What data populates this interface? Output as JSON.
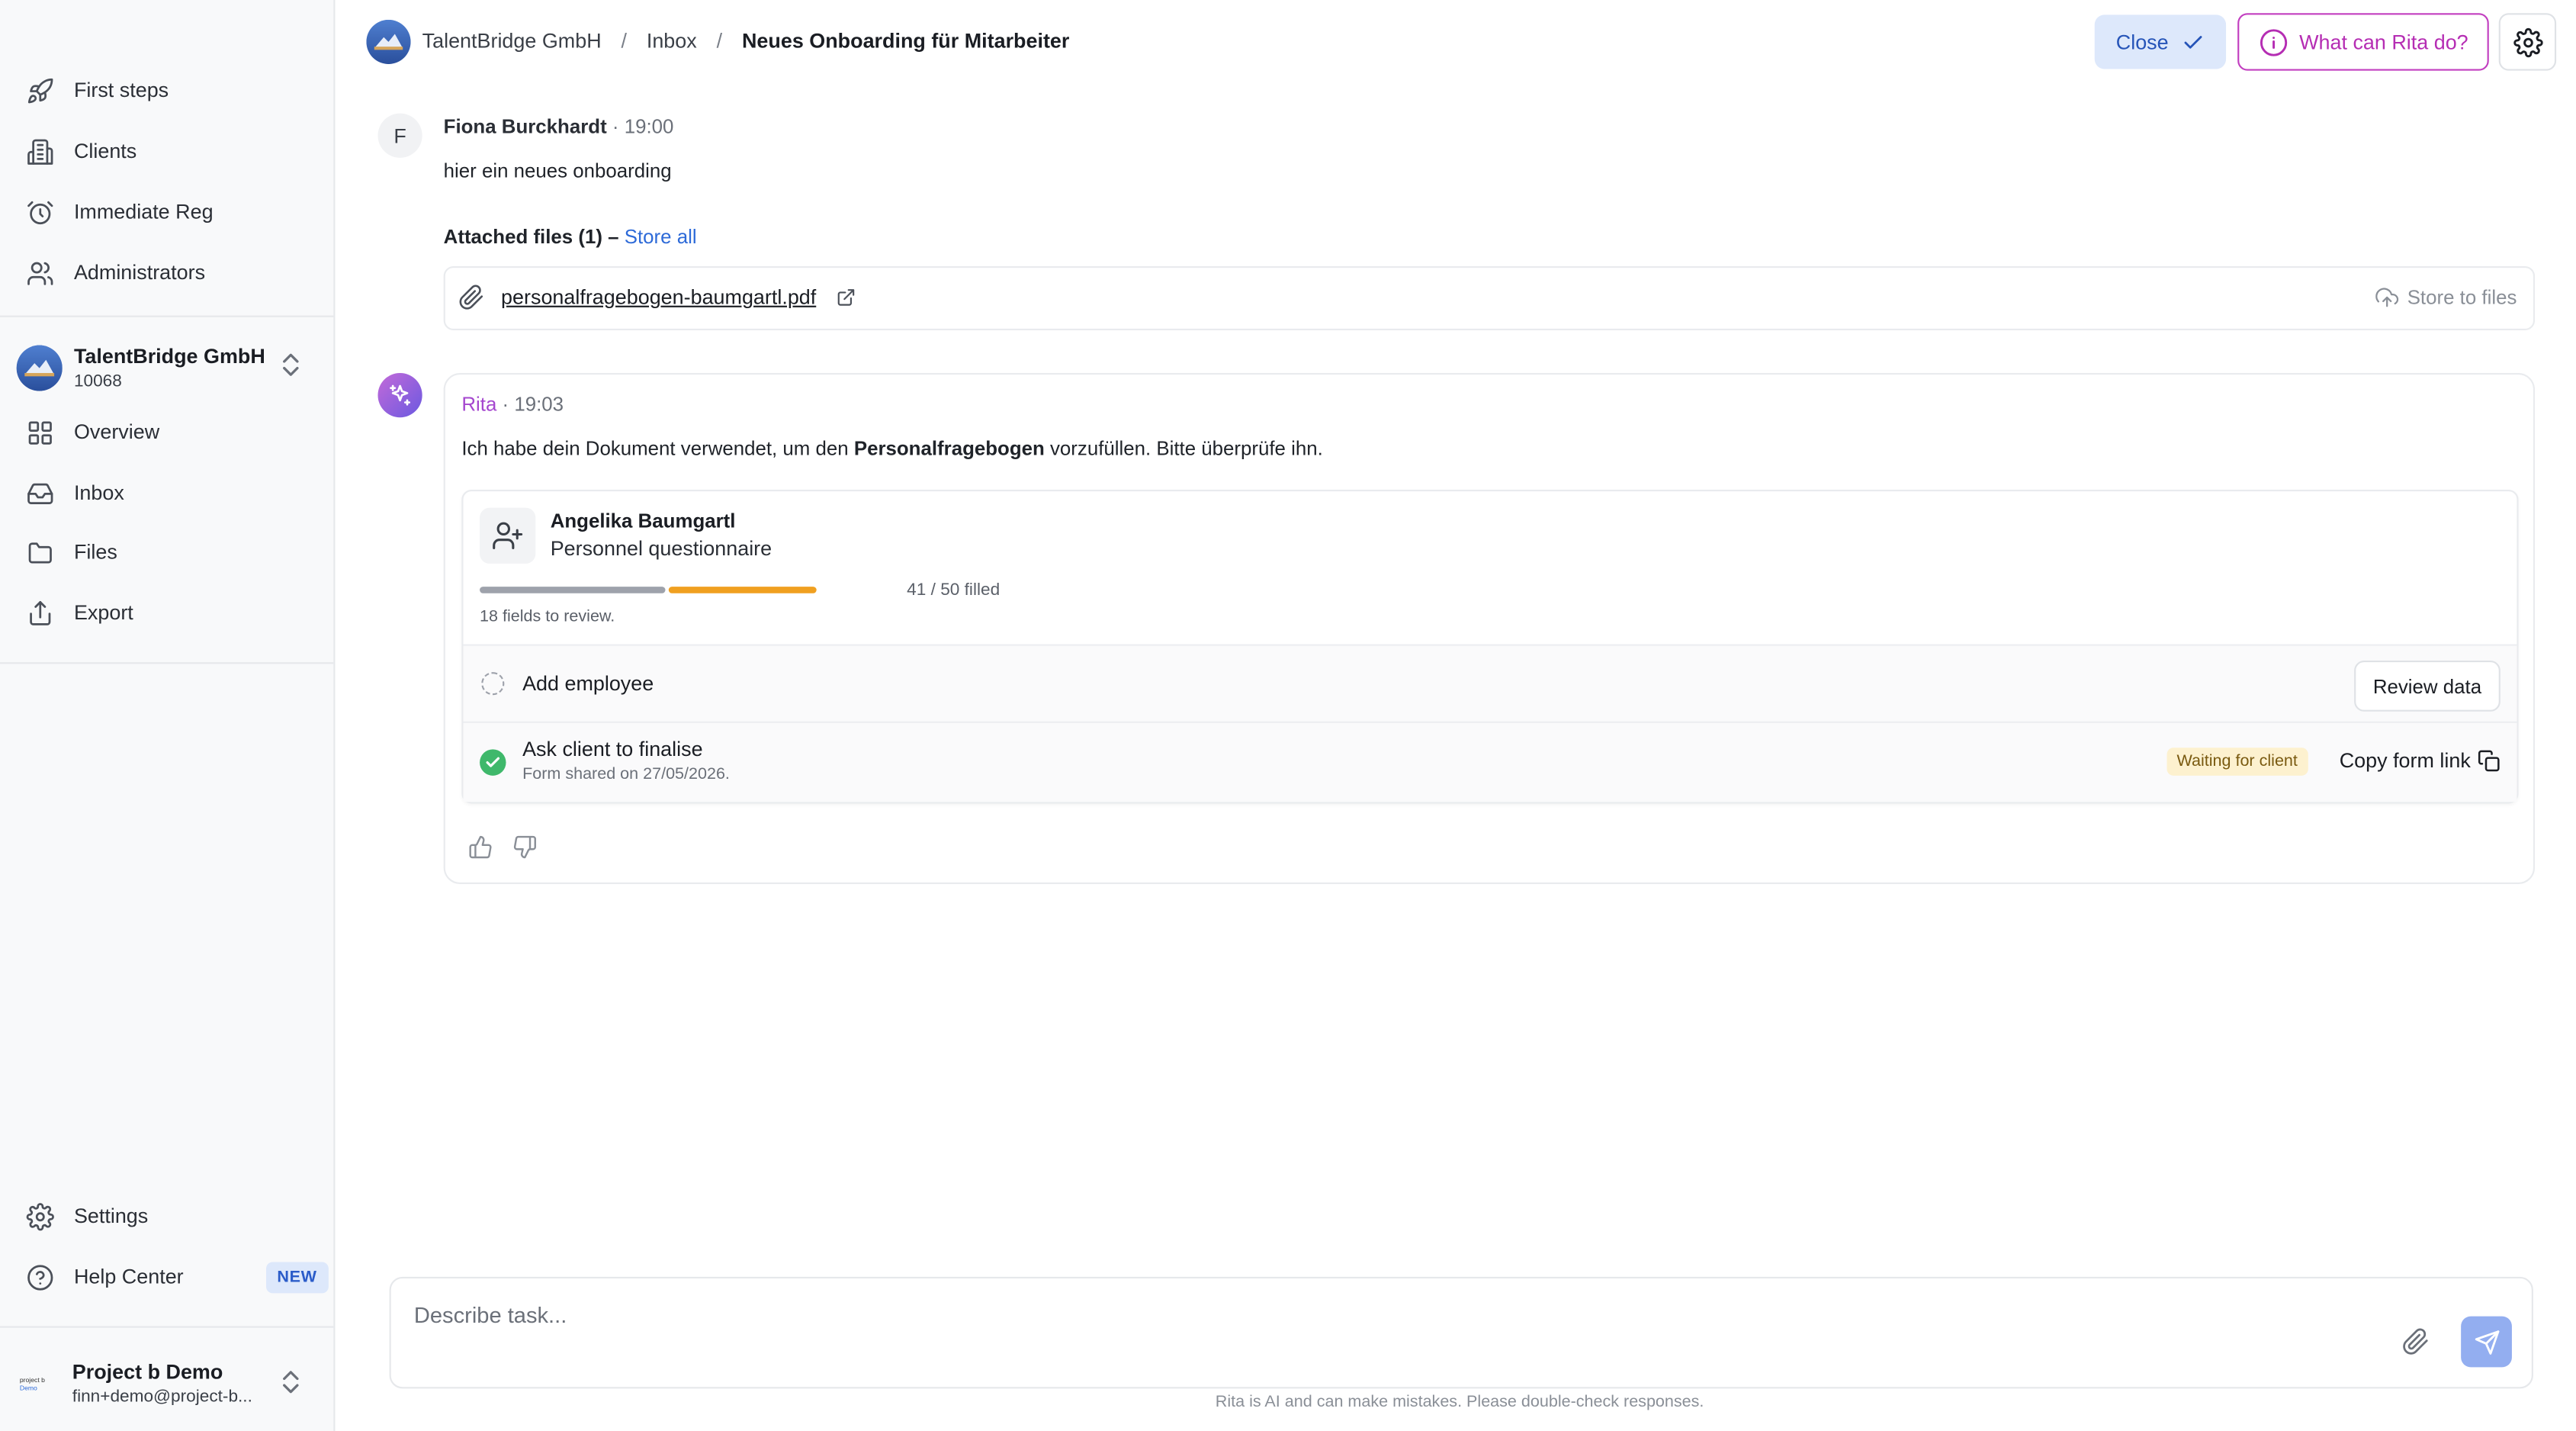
{
  "sidebar": {
    "top_items": [
      {
        "label": "First steps",
        "icon": "rocket-icon"
      },
      {
        "label": "Clients",
        "icon": "building-icon"
      },
      {
        "label": "Immediate Reg",
        "icon": "alarm-icon"
      },
      {
        "label": "Administrators",
        "icon": "users-icon"
      }
    ],
    "org": {
      "name": "TalentBridge GmbH",
      "id": "10068"
    },
    "org_items": [
      {
        "label": "Overview",
        "icon": "grid-icon"
      },
      {
        "label": "Inbox",
        "icon": "inbox-icon"
      },
      {
        "label": "Files",
        "icon": "folder-icon"
      },
      {
        "label": "Export",
        "icon": "export-icon"
      }
    ],
    "settings_label": "Settings",
    "help_label": "Help Center",
    "help_badge": "NEW",
    "user": {
      "name": "Project b Demo",
      "email": "finn+demo@project-b...",
      "logo_line1": "project b",
      "logo_line2": "Demo"
    }
  },
  "header": {
    "breadcrumbs": [
      "TalentBridge GmbH",
      "Inbox",
      "Neues Onboarding für Mitarbeiter"
    ],
    "separator": "/",
    "close_label": "Close",
    "rita_label": "What can Rita do?"
  },
  "message1": {
    "avatar_letter": "F",
    "author": "Fiona Burckhardt",
    "time": "19:00",
    "text": "hier ein neues onboarding",
    "attached_label": "Attached files (1) –",
    "store_all": "Store all",
    "file_name": "personalfragebogen-baumgartl.pdf",
    "store_to_files": "Store to files"
  },
  "message2": {
    "author": "Rita",
    "time": "19:03",
    "text_before": "Ich habe dein Dokument verwendet, um den ",
    "text_bold": "Personalfragebogen",
    "text_after": " vorzufüllen. Bitte überprüfe ihn.",
    "card": {
      "person_name": "Angelika Baumgartl",
      "form_name": "Personnel questionnaire",
      "progress": {
        "filled": 41,
        "total": 50,
        "review": 18
      },
      "filled_label": "41 / 50 filled",
      "review_note": "18 fields to review.",
      "step1": {
        "title": "Add employee",
        "button": "Review data"
      },
      "step2": {
        "title": "Ask client to finalise",
        "subtitle": "Form shared on 27/05/2026.",
        "badge": "Waiting for client",
        "copy_label": "Copy form link"
      }
    }
  },
  "composer": {
    "placeholder": "Describe task...",
    "disclaimer": "Rita is AI and can make mistakes. Please double-check responses."
  },
  "colors": {
    "accent": "#2d6ad8",
    "rita": "#b52db3",
    "progress_review": "#f0a020",
    "success": "#3fb86b"
  }
}
